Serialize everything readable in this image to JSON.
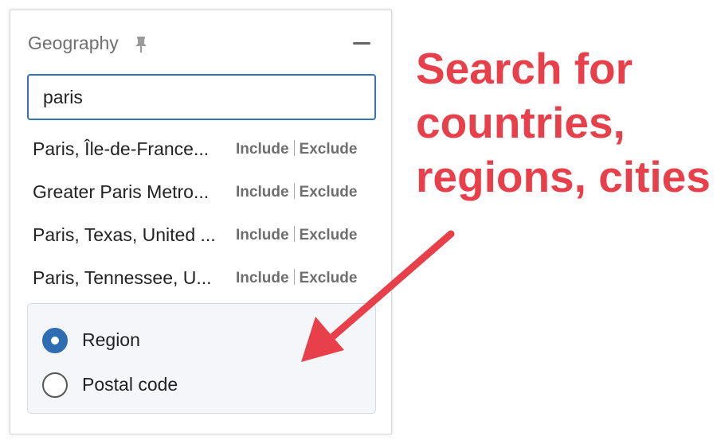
{
  "panel": {
    "title": "Geography",
    "search": {
      "value": "paris"
    },
    "results": [
      {
        "label": "Paris, Île-de-France...",
        "include": "Include",
        "exclude": "Exclude"
      },
      {
        "label": "Greater Paris Metro...",
        "include": "Include",
        "exclude": "Exclude"
      },
      {
        "label": "Paris, Texas, United ...",
        "include": "Include",
        "exclude": "Exclude"
      },
      {
        "label": "Paris, Tennessee, U...",
        "include": "Include",
        "exclude": "Exclude"
      }
    ],
    "location_mode": {
      "options": [
        {
          "label": "Region",
          "selected": true
        },
        {
          "label": "Postal code",
          "selected": false
        }
      ]
    }
  },
  "annotation": {
    "lines": [
      "Search for",
      "countries,",
      "regions, cities"
    ],
    "color": "#e8404a"
  },
  "colors": {
    "accent": "#3572b0",
    "radio_selected": "#2f6db3",
    "action_text": "#6e6e6e"
  }
}
